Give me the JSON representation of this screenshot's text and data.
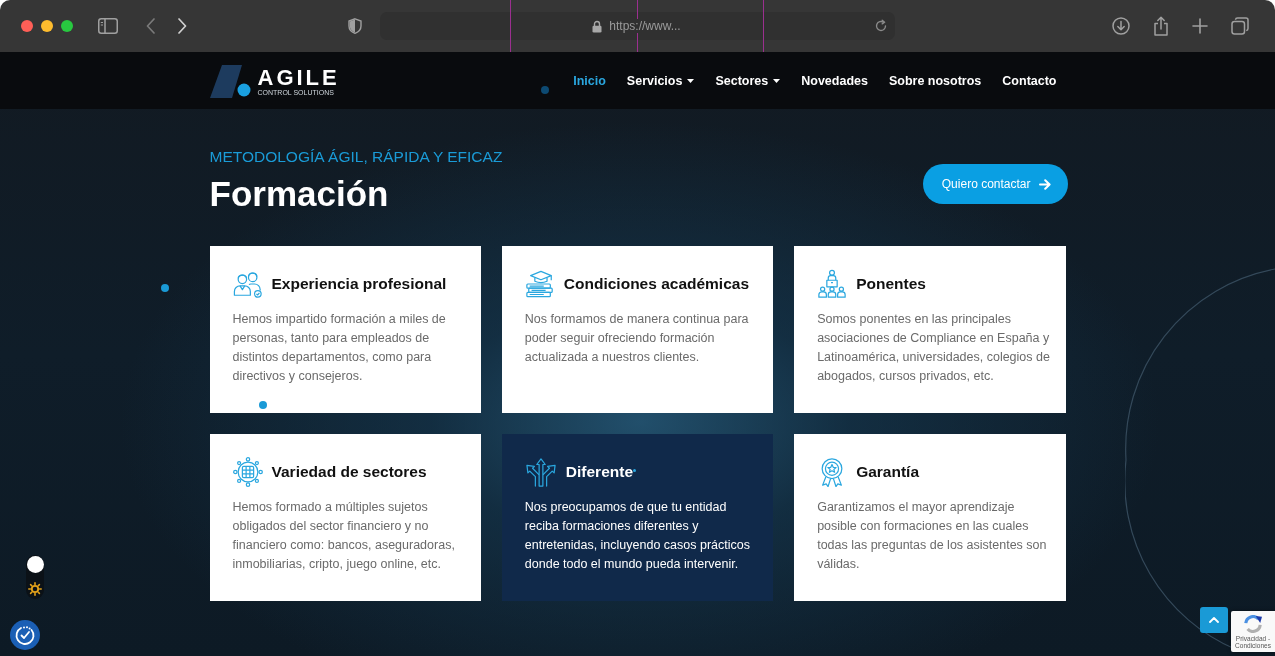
{
  "browser": {
    "url": "https://www..."
  },
  "nav": {
    "logo": {
      "name": "AGILE",
      "tagline": "CONTROL SOLUTIONS"
    },
    "items": [
      {
        "label": "Inicio",
        "selected": true,
        "dropdown": false
      },
      {
        "label": "Servicios",
        "selected": false,
        "dropdown": true
      },
      {
        "label": "Sectores",
        "selected": false,
        "dropdown": true
      },
      {
        "label": "Novedades",
        "selected": false,
        "dropdown": false
      },
      {
        "label": "Sobre nosotros",
        "selected": false,
        "dropdown": false
      },
      {
        "label": "Contacto",
        "selected": false,
        "dropdown": false
      }
    ]
  },
  "hero": {
    "eyebrow": "METODOLOGÍA ÁGIL, RÁPIDA Y EFICAZ",
    "title": "Formación",
    "button": "Quiero contactar"
  },
  "cards": [
    {
      "title": "Experiencia profesional",
      "text": "Hemos impartido formación a miles de personas, tanto para empleados de distintos departamentos, como para directivos y consejeros.",
      "highlighted": false
    },
    {
      "title": "Condiciones académicas",
      "text": "Nos formamos de manera continua para poder seguir ofreciendo formación actualizada a nuestros clientes.",
      "highlighted": false
    },
    {
      "title": "Ponentes",
      "text": "Somos ponentes en las principales asociaciones de Compliance en España y Latinoamérica, universidades, colegios de abogados, cursos privados, etc.",
      "highlighted": false
    },
    {
      "title": "Variedad de sectores",
      "text": "Hemos formado a múltiples sujetos obligados del sector financiero y no financiero como: bancos, aseguradoras, inmobiliarias, cripto, juego online, etc.",
      "highlighted": false
    },
    {
      "title": "Diferente",
      "text": "Nos preocupamos de que tu entidad reciba formaciones diferentes y entretenidas, incluyendo casos prácticos donde todo el mundo pueda intervenir.",
      "highlighted": true
    },
    {
      "title": "Garantía",
      "text": "Garantizamos el mayor aprendizaje posible con formaciones en las cuales todas las preguntas de los asistentes son válidas.",
      "highlighted": false
    }
  ],
  "recaptcha": {
    "text": "Privacidad - Condiciones"
  }
}
